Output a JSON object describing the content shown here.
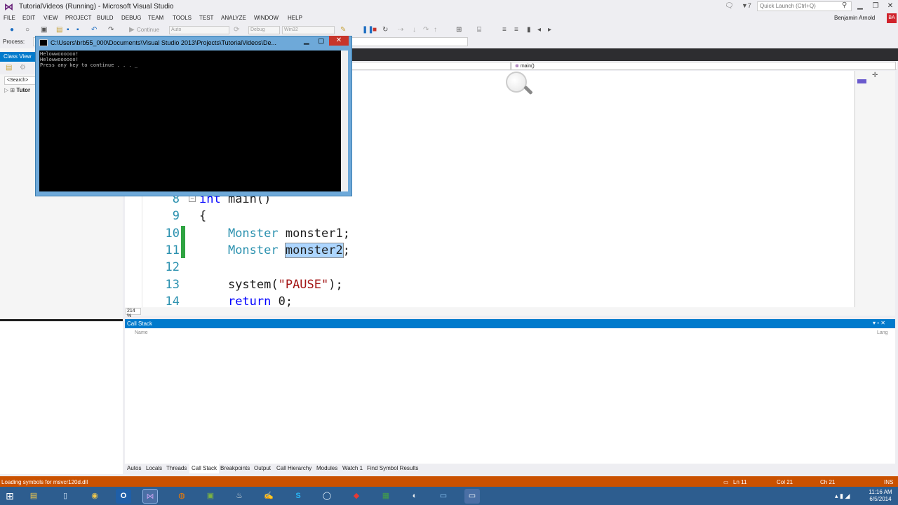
{
  "window": {
    "title": "TutorialVideos (Running) - Microsoft Visual Studio"
  },
  "titlebar": {
    "notifications": "🗨",
    "filter_count": "▼7",
    "quick_launch_placeholder": "Quick Launch (Ctrl+Q)",
    "user": "Benjamin Arnold",
    "user_initials": "BA"
  },
  "menu": [
    "FILE",
    "EDIT",
    "VIEW",
    "PROJECT",
    "BUILD",
    "DEBUG",
    "TEAM",
    "TOOLS",
    "TEST",
    "ANALYZE",
    "WINDOW",
    "HELP"
  ],
  "toolbar": {
    "continue_label": "Continue",
    "auto_label": "Auto",
    "config": "Debug",
    "platform": "Win32",
    "process_label": "Process:"
  },
  "class_view": {
    "title": "Class View",
    "search": "<Search>",
    "tree_item": "Tutor"
  },
  "editor": {
    "nav_right": "main()",
    "zoom": "214 %",
    "lines": [
      {
        "num": "8",
        "parts": [
          {
            "t": "int",
            "c": "kw"
          },
          {
            "t": " main()",
            "c": ""
          }
        ]
      },
      {
        "num": "9",
        "parts": [
          {
            "t": "{",
            "c": ""
          }
        ]
      },
      {
        "num": "10",
        "parts": [
          {
            "t": "    ",
            "c": ""
          },
          {
            "t": "Monster",
            "c": "ty"
          },
          {
            "t": " monster1;",
            "c": ""
          }
        ]
      },
      {
        "num": "11",
        "parts": [
          {
            "t": "    ",
            "c": ""
          },
          {
            "t": "Monster",
            "c": "ty"
          },
          {
            "t": " ",
            "c": ""
          },
          {
            "t": "monster2",
            "c": "hl"
          },
          {
            "t": ";",
            "c": ""
          }
        ]
      },
      {
        "num": "12",
        "parts": []
      },
      {
        "num": "13",
        "parts": [
          {
            "t": "    system(",
            "c": ""
          },
          {
            "t": "\"PAUSE\"",
            "c": "str"
          },
          {
            "t": ");",
            "c": ""
          }
        ]
      },
      {
        "num": "14",
        "parts": [
          {
            "t": "    ",
            "c": ""
          },
          {
            "t": "return",
            "c": "kw"
          },
          {
            "t": " 0;",
            "c": ""
          }
        ]
      }
    ]
  },
  "console": {
    "title": "C:\\Users\\brb55_000\\Documents\\Visual Studio 2013\\Projects\\TutorialVideos\\De...",
    "lines": [
      "Helowwoooooo!",
      "Helowwoooooo!",
      "Press any key to continue . . . _"
    ]
  },
  "call_stack": {
    "title": "Call Stack",
    "col_name": "Name",
    "col_lang": "Lang"
  },
  "debug_tabs": [
    "Autos",
    "Locals",
    "Threads",
    "Call Stack",
    "Breakpoints",
    "Output",
    "Call Hierarchy",
    "Modules",
    "Watch 1",
    "Find Symbol Results"
  ],
  "status": {
    "message": "Loading symbols for msvcr120d.dll",
    "ln": "Ln 11",
    "col": "Col 21",
    "ch": "Ch 21",
    "mode": "INS"
  },
  "taskbar": {
    "time": "11:16 AM",
    "date": "6/5/2014"
  },
  "colors": {
    "accent": "#007acc",
    "status_debug": "#ca5100",
    "taskbar": "#2d5d8f"
  }
}
